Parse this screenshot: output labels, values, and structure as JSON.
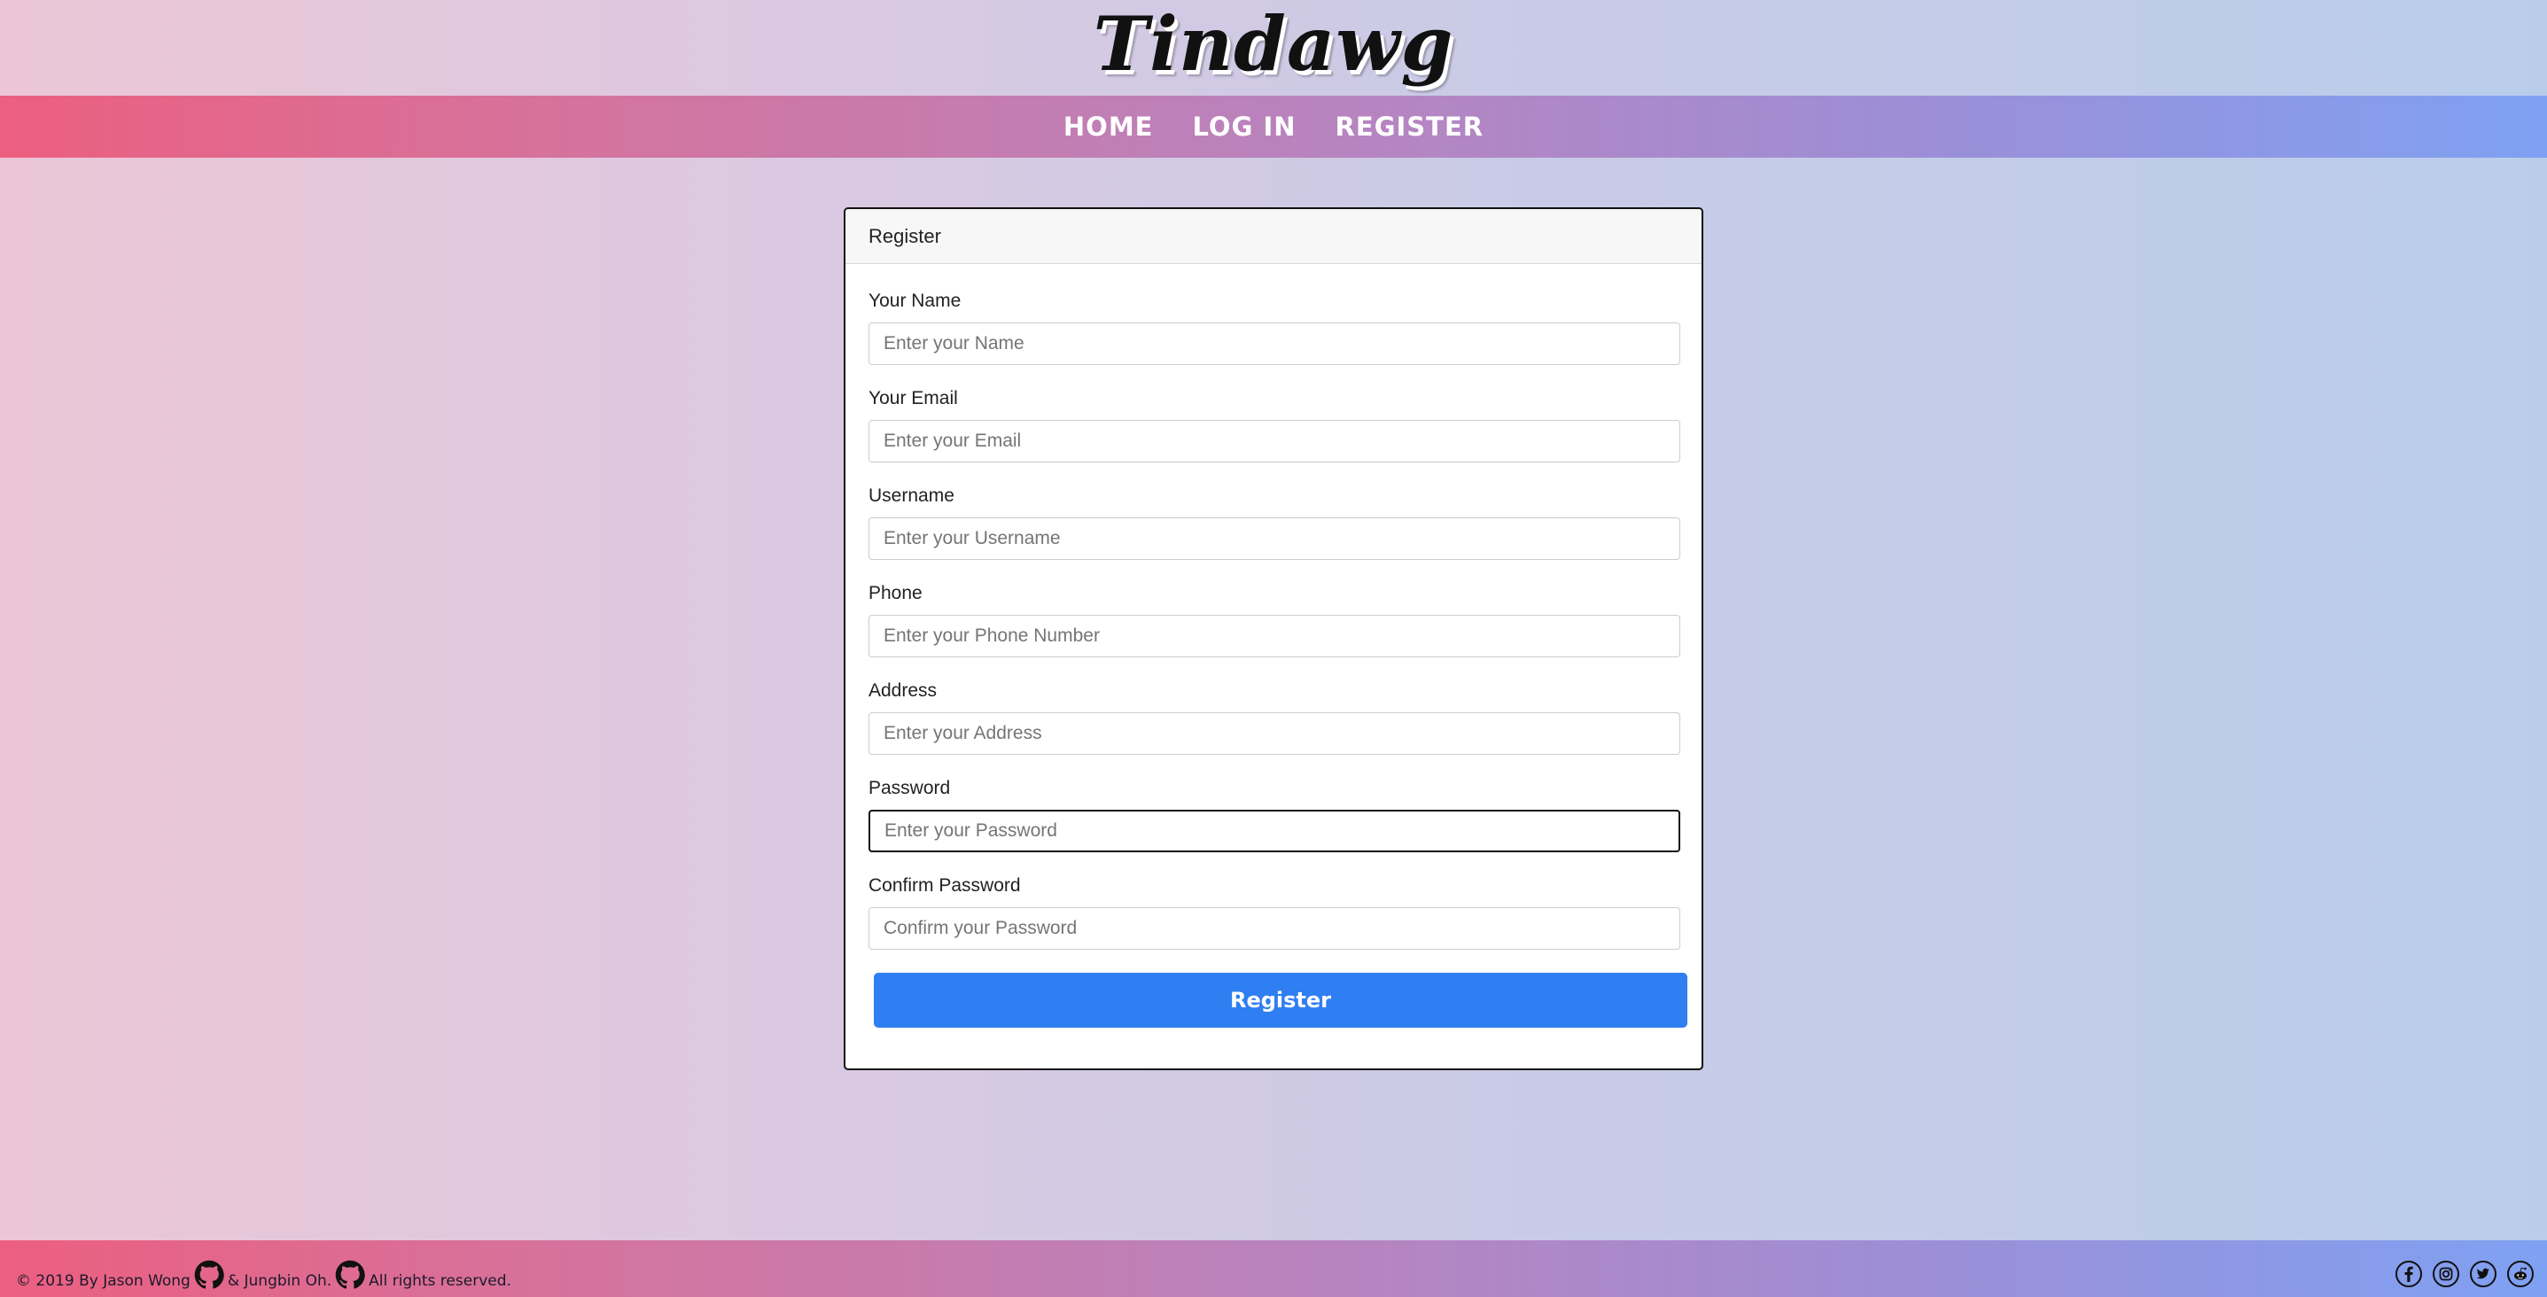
{
  "brand": {
    "logo_text": "Tindawg"
  },
  "nav": {
    "items": [
      {
        "label": "HOME"
      },
      {
        "label": "LOG IN"
      },
      {
        "label": "REGISTER"
      }
    ]
  },
  "form": {
    "title": "Register",
    "fields": [
      {
        "label": "Your Name",
        "placeholder": "Enter your Name",
        "value": ""
      },
      {
        "label": "Your Email",
        "placeholder": "Enter your Email",
        "value": ""
      },
      {
        "label": "Username",
        "placeholder": "Enter your Username",
        "value": ""
      },
      {
        "label": "Phone",
        "placeholder": "Enter your Phone Number",
        "value": ""
      },
      {
        "label": "Address",
        "placeholder": "Enter your Address",
        "value": ""
      },
      {
        "label": "Password",
        "placeholder": "Enter your Password",
        "value": ""
      },
      {
        "label": "Confirm Password",
        "placeholder": "Confirm your Password",
        "value": ""
      }
    ],
    "submit_label": "Register",
    "focused_field": "Password"
  },
  "footer": {
    "text_part1": "© 2019 By Jason Wong",
    "text_part2": "& Jungbin Oh.",
    "text_part3": "All rights reserved.",
    "social_icons": [
      "facebook-icon",
      "instagram-icon",
      "twitter-icon",
      "reddit-icon"
    ]
  },
  "colors": {
    "accent_button": "#2f7ef2",
    "nav_gradient_start": "#ec5f80",
    "nav_gradient_end": "#7fa1f3"
  }
}
